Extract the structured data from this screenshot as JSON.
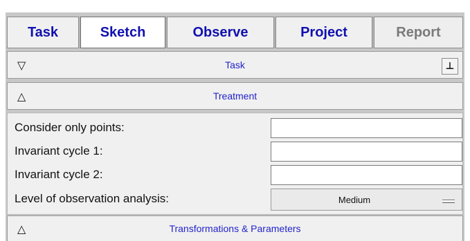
{
  "tabs": [
    {
      "label": "Task",
      "state": "normal"
    },
    {
      "label": "Sketch",
      "state": "active"
    },
    {
      "label": "Observe",
      "state": "normal"
    },
    {
      "label": "Project",
      "state": "normal"
    },
    {
      "label": "Report",
      "state": "disabled"
    }
  ],
  "sections": {
    "task": {
      "title": "Task",
      "icon": "triangle-down-icon",
      "pin_icon": "pin-icon"
    },
    "treatment": {
      "title": "Treatment",
      "icon": "triangle-up-icon"
    },
    "transformations": {
      "title": "Transformations & Parameters",
      "icon": "triangle-up-icon"
    }
  },
  "treatment_form": {
    "consider_points_label": "Consider only points:",
    "consider_points_value": "",
    "invariant_cycle1_label": "Invariant cycle 1:",
    "invariant_cycle1_value": "",
    "invariant_cycle2_label": "Invariant cycle 2:",
    "invariant_cycle2_value": "",
    "observation_level_label": "Level of observation analysis:",
    "observation_level_value": "Medium"
  },
  "colors": {
    "tab_text": "#1010b0",
    "section_title": "#2222cc",
    "disabled_text": "#7a7a7a"
  }
}
